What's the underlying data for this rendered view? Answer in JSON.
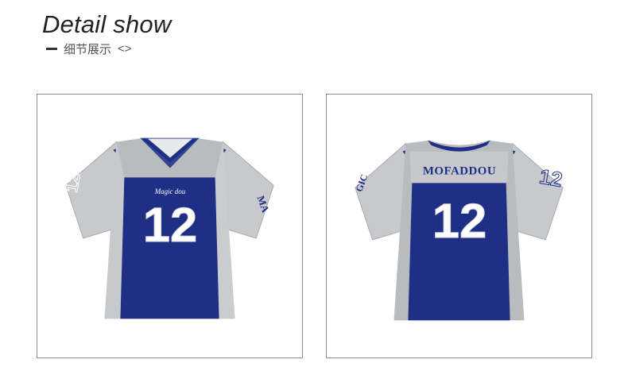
{
  "header": {
    "title": "Detail show",
    "subtitle": "细节展示",
    "subtitle_mark": "<>"
  },
  "front_jersey": {
    "number": "12",
    "script_brand": "Magic dou",
    "sleeve_text": "MA",
    "sleeve_number": "12"
  },
  "back_jersey": {
    "name": "MOFADDOU",
    "number": "12",
    "sleeve_text": "GIC",
    "sleeve_number": "12"
  },
  "colors": {
    "navy": "#1f2f86",
    "gray": "#b9bcbf",
    "light_gray": "#d8dadc",
    "white": "#ffffff"
  }
}
